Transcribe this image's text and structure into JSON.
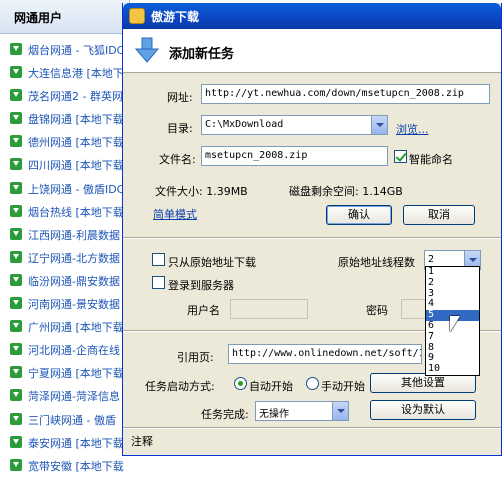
{
  "background": {
    "header": "网通用户",
    "rows": [
      "烟台网通 - 飞狐IDC",
      "大连信息港 [本地下载",
      "茂名网通2 - 群英网",
      "盘锦网通 [本地下载",
      "德州网通 [本地下载",
      "四川网通 [本地下载",
      "上饶网通 - 傲盾IDC",
      "烟台热线 [本地下载",
      "江西网通-利晨数据",
      "辽宁网通-北方数据",
      "临汾网通-鼎安数据",
      "河南网通-景安数据",
      "广州网通 [本地下载",
      "河北网通-企商在线",
      "宁夏网通 [本地下载",
      "菏泽网通-菏泽信息",
      "三门峡网通 - 傲盾",
      "泰安网通 [本地下载",
      "宽带安徽 [本地下载"
    ]
  },
  "dialog": {
    "title": "傲游下载",
    "header_title": "添加新任务",
    "url_label": "网址:",
    "url_value": "http://yt.newhua.com/down/msetupcn_2008.zip",
    "dir_label": "目录:",
    "dir_value": "C:\\MxDownload",
    "browse_label": "浏览...",
    "filename_label": "文件名:",
    "filename_value": "msetupcn_2008.zip",
    "smart_name_label": "智能命名",
    "smart_name_checked": true,
    "file_size": "文件大小: 1.39MB",
    "disk_free": "磁盘剩余空间: 1.14GB",
    "simple_mode_label": "简单模式",
    "ok_label": "确认",
    "cancel_label": "取消",
    "only_origin_label": "只从原始地址下载",
    "origin_threads_label": "原始地址线程数",
    "threads_value": "2",
    "threads_options": [
      "1",
      "2",
      "3",
      "4",
      "5",
      "6",
      "7",
      "8",
      "9",
      "10"
    ],
    "threads_highlighted": "5",
    "login_label": "登录到服务器",
    "username_label": "用户名",
    "password_label": "密码",
    "referer_label": "引用页:",
    "referer_value": "http://www.onlinedown.net/soft/1558",
    "start_mode_label": "任务启动方式:",
    "auto_start_label": "自动开始",
    "manual_start_label": "手动开始",
    "other_settings_label": "其他设置",
    "on_complete_label": "任务完成:",
    "on_complete_value": "无操作",
    "set_default_label": "设为默认",
    "notes_label": "注释"
  },
  "colors": {
    "titlebar": "#0b45c2",
    "dialog_bg": "#ece9d8",
    "link": "#1d56b7",
    "selection": "#316ac5"
  }
}
